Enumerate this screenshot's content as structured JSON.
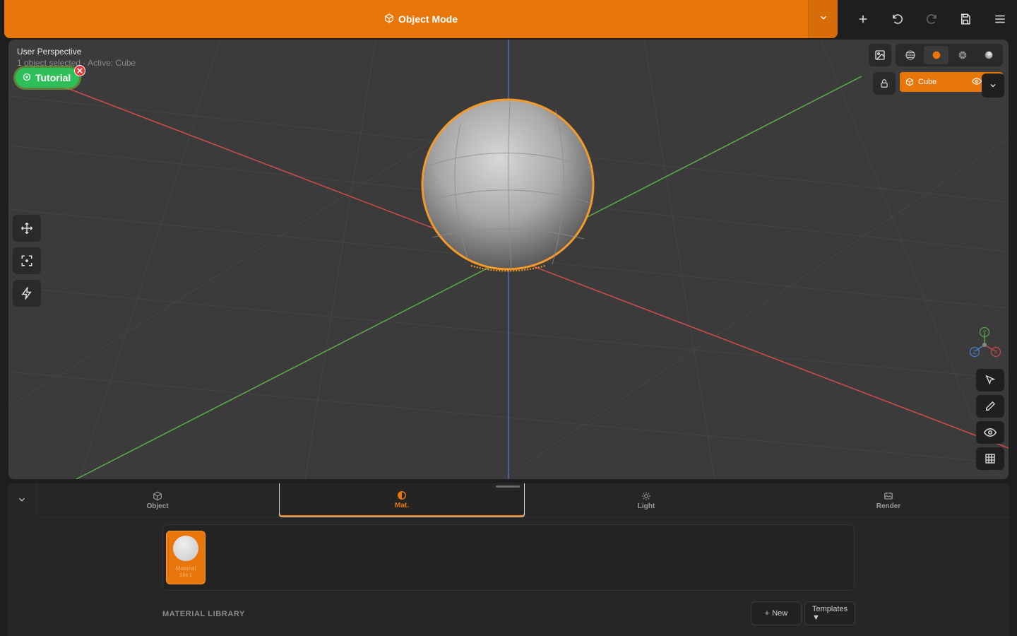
{
  "topbar": {
    "mode_label": "Object Mode",
    "mode_icon": "cube-icon",
    "actions": [
      "add-icon",
      "undo-icon",
      "redo-icon",
      "save-icon",
      "menu-icon"
    ]
  },
  "viewport": {
    "title": "User Perspective",
    "subtitle": "1 object selected · Active: Cube",
    "tutorial_label": "Tutorial",
    "active_object": "Cube",
    "shading_modes": [
      "wireframe-icon",
      "solid-icon",
      "material-icon",
      "rendered-icon"
    ],
    "active_shading": "solid-icon",
    "gizmo_labels": {
      "y": "Y",
      "z": "Z",
      "x": "X"
    },
    "left_tools": [
      "move-icon",
      "frame-icon",
      "quick-action-icon"
    ],
    "right_tools": [
      "select-icon",
      "draw-icon",
      "visibility-icon",
      "grid-icon"
    ]
  },
  "panel": {
    "tabs": [
      {
        "label": "Object",
        "icon": "cube-icon"
      },
      {
        "label": "Mat.",
        "icon": "material-icon"
      },
      {
        "label": "Light",
        "icon": "light-icon"
      },
      {
        "label": "Render",
        "icon": "render-icon"
      }
    ],
    "active_tab": "Mat.",
    "slot_name": "Material",
    "slot_sub": "Slot 1",
    "library_title": "MATERIAL LIBRARY",
    "new_label": "New",
    "templates_label": "Templates",
    "templates_caret": "▼"
  },
  "colors": {
    "accent": "#e8760b",
    "viewport_bg": "#3b3b3b",
    "axis_x": "#c84b4b",
    "axis_y": "#5aa64a",
    "axis_z": "#4a7fc8",
    "tutorial": "#2fbf59"
  }
}
